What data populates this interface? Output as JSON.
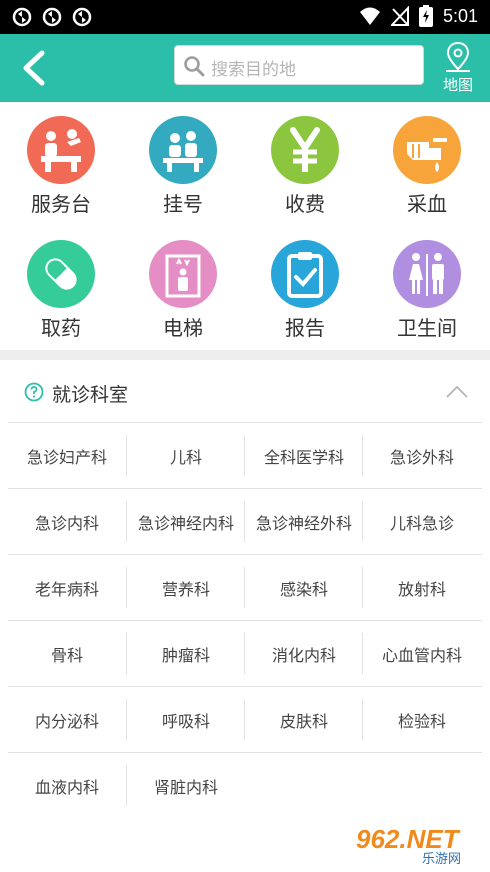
{
  "status_bar": {
    "time": "5:01"
  },
  "header": {
    "search_placeholder": "搜索目的地",
    "map_label": "地图",
    "accent_color": "#2bbfa9"
  },
  "services": [
    {
      "label": "服务台",
      "icon": "service-desk-icon",
      "color": "#f06a55"
    },
    {
      "label": "挂号",
      "icon": "registration-icon",
      "color": "#33aabf"
    },
    {
      "label": "收费",
      "icon": "yen-icon",
      "color": "#8cc63f"
    },
    {
      "label": "采血",
      "icon": "blood-draw-icon",
      "color": "#f7a43b"
    },
    {
      "label": "取药",
      "icon": "pill-icon",
      "color": "#35cc9a"
    },
    {
      "label": "电梯",
      "icon": "elevator-icon",
      "color": "#e58ec6"
    },
    {
      "label": "报告",
      "icon": "clipboard-icon",
      "color": "#29a6d9"
    },
    {
      "label": "卫生间",
      "icon": "restroom-icon",
      "color": "#b08fe0"
    }
  ],
  "departments": {
    "title": "就诊科室",
    "items": [
      "急诊妇产科",
      "儿科",
      "全科医学科",
      "急诊外科",
      "急诊内科",
      "急诊神经内科",
      "急诊神经外科",
      "儿科急诊",
      "老年病科",
      "营养科",
      "感染科",
      "放射科",
      "骨科",
      "肿瘤科",
      "消化内科",
      "心血管内科",
      "内分泌科",
      "呼吸科",
      "皮肤科",
      "检验科",
      "血液内科",
      "肾脏内科"
    ]
  },
  "watermark": {
    "brand": "962.NET",
    "sub": "乐游网"
  }
}
